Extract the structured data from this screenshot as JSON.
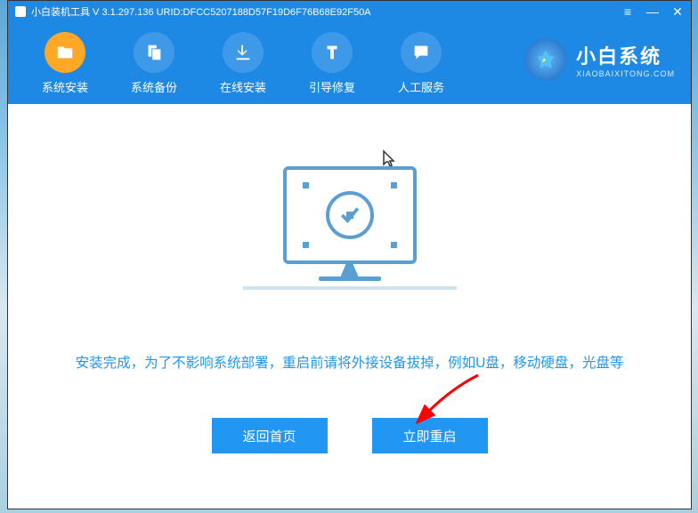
{
  "titlebar": {
    "title": "小白装机工具 V 3.1.297.136 URID:DFCC5207188D57F19D6F76B68E92F50A"
  },
  "toolbar": {
    "items": [
      {
        "label": "系统安装",
        "icon": "folder"
      },
      {
        "label": "系统备份",
        "icon": "copy"
      },
      {
        "label": "在线安装",
        "icon": "download"
      },
      {
        "label": "引导修复",
        "icon": "repair"
      },
      {
        "label": "人工服务",
        "icon": "chat"
      }
    ]
  },
  "brand": {
    "name": "小白系统",
    "sub": "XIAOBAIXITONG.COM"
  },
  "main": {
    "message": "安装完成，为了不影响系统部署，重启前请将外接设备拔掉，例如U盘，移动硬盘，光盘等",
    "back_button": "返回首页",
    "restart_button": "立即重启"
  }
}
